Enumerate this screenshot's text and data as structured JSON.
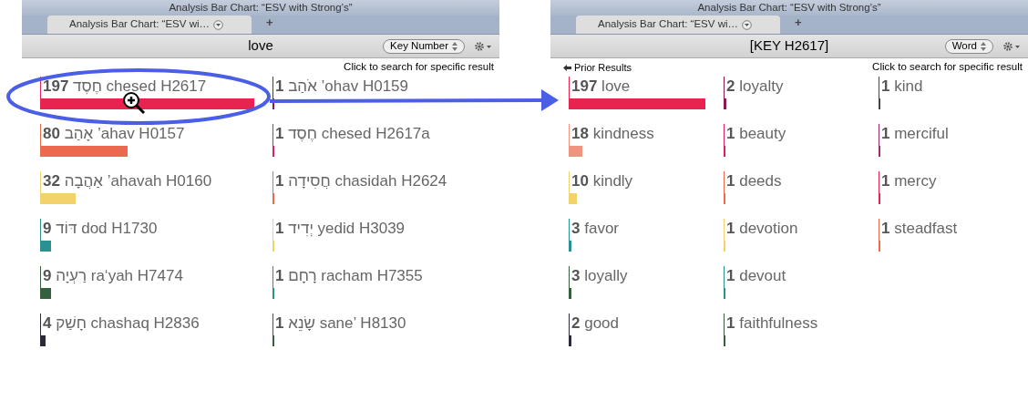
{
  "panels": [
    {
      "window_title": "Analysis Bar Chart: “ESV with Strong’s”",
      "tab": {
        "label": "Analysis Bar Chart: “ESV wi…",
        "selected": true
      },
      "new_tab": "+",
      "query": "love",
      "sort_popup": "Key Number",
      "hint": "Click to search for specific result",
      "columns": [
        [
          {
            "count": "197",
            "label": "חֶסֶד chesed H2617",
            "color": "#e8234f"
          },
          {
            "count": "80",
            "label": "אָהַב ’ahav H0157",
            "color": "#eb6a4f"
          },
          {
            "count": "32",
            "label": "אַהֲבָה ’ahavah H0160",
            "color": "#f2d36b"
          },
          {
            "count": "9",
            "label": "דּוֹד dod H1730",
            "color": "#2a9090"
          },
          {
            "count": "9",
            "label": "רַעְיָה ra‘yah H7474",
            "color": "#356040"
          },
          {
            "count": "4",
            "label": "חָשַׁק chashaq H2836",
            "color": "#2a2a3a"
          }
        ],
        [
          {
            "count": "1",
            "label": "אֹהַב ’ohav H0159",
            "color": "#8a1a50"
          },
          {
            "count": "1",
            "label": "חֶסֶד chesed H2617a",
            "color": "#d9235a"
          },
          {
            "count": "1",
            "label": "חֲסִידָה chasidah H2624",
            "color": "#eb6a4f"
          },
          {
            "count": "1",
            "label": "יְדִיד yedid H3039",
            "color": "#f2d36b"
          },
          {
            "count": "1",
            "label": "רָחָם racham H7355",
            "color": "#2a9090"
          },
          {
            "count": "1",
            "label": "שָׂנֵא sane’ H8130",
            "color": "#356040"
          }
        ]
      ]
    },
    {
      "window_title": "Analysis Bar Chart: “ESV with Strong’s”",
      "tab": {
        "label": "Analysis Bar Chart: “ESV wi…",
        "selected": true
      },
      "new_tab": "+",
      "query": "[KEY H2617]",
      "sort_popup": "Word",
      "back_link": "Prior Results",
      "hint": "Click to search for specific result",
      "columns": [
        [
          {
            "count": "197",
            "label": "love",
            "color": "#e8234f"
          },
          {
            "count": "18",
            "label": "kindness",
            "color": "#f0947f"
          },
          {
            "count": "10",
            "label": "kindly",
            "color": "#f2d36b"
          },
          {
            "count": "3",
            "label": "favor",
            "color": "#2a9090"
          },
          {
            "count": "3",
            "label": "loyally",
            "color": "#356040"
          },
          {
            "count": "2",
            "label": "good",
            "color": "#2a2a3a"
          }
        ],
        [
          {
            "count": "2",
            "label": "loyalty",
            "color": "#8a1a50"
          },
          {
            "count": "1",
            "label": "beauty",
            "color": "#d9235a"
          },
          {
            "count": "1",
            "label": "deeds",
            "color": "#eb6a4f"
          },
          {
            "count": "1",
            "label": "devotion",
            "color": "#f2d36b"
          },
          {
            "count": "1",
            "label": "devout",
            "color": "#2a9090"
          },
          {
            "count": "1",
            "label": "faithfulness",
            "color": "#356040"
          }
        ],
        [
          {
            "count": "1",
            "label": "kind",
            "color": "#444444"
          },
          {
            "count": "1",
            "label": "merciful",
            "color": "#a02a70"
          },
          {
            "count": "1",
            "label": "mercy",
            "color": "#e8234f"
          },
          {
            "count": "1",
            "label": "steadfast",
            "color": "#eb6a4f"
          }
        ]
      ]
    }
  ]
}
